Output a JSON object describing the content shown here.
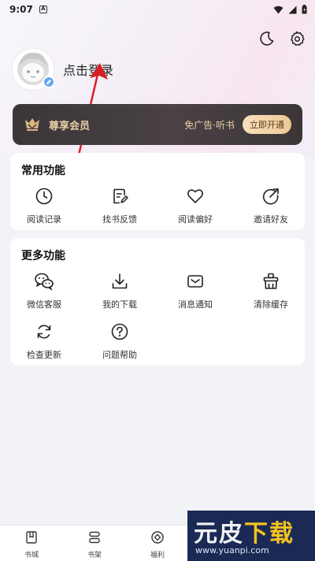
{
  "status_bar": {
    "time": "9:07",
    "notification_icon": "A"
  },
  "header": {
    "icons": [
      "moon-icon",
      "gear-icon"
    ]
  },
  "profile": {
    "login_label": "点击登录"
  },
  "vip": {
    "title": "尊享会员",
    "subtitle": "免广告·听书",
    "button": "立即开通",
    "accent": "#e9cfa6"
  },
  "common": {
    "title": "常用功能",
    "items": [
      {
        "label": "阅读记录",
        "icon": "clock-icon"
      },
      {
        "label": "找书反馈",
        "icon": "feedback-icon"
      },
      {
        "label": "阅读偏好",
        "icon": "heart-icon"
      },
      {
        "label": "邀请好友",
        "icon": "share-icon"
      }
    ]
  },
  "more": {
    "title": "更多功能",
    "items": [
      {
        "label": "微信客服",
        "icon": "wechat-icon"
      },
      {
        "label": "我的下载",
        "icon": "download-icon"
      },
      {
        "label": "消息通知",
        "icon": "mail-icon"
      },
      {
        "label": "清除缓存",
        "icon": "broom-icon"
      },
      {
        "label": "检查更新",
        "icon": "refresh-icon"
      },
      {
        "label": "问题帮助",
        "icon": "help-icon"
      }
    ]
  },
  "bottom_nav": {
    "items": [
      {
        "label": "书城",
        "icon": "book-icon"
      },
      {
        "label": "书架",
        "icon": "shelf-icon"
      },
      {
        "label": "福利",
        "icon": "gift-icon"
      }
    ]
  },
  "watermark": {
    "text_white": "元皮",
    "text_yellow": "下载",
    "url": "www.yuanpi.com"
  }
}
